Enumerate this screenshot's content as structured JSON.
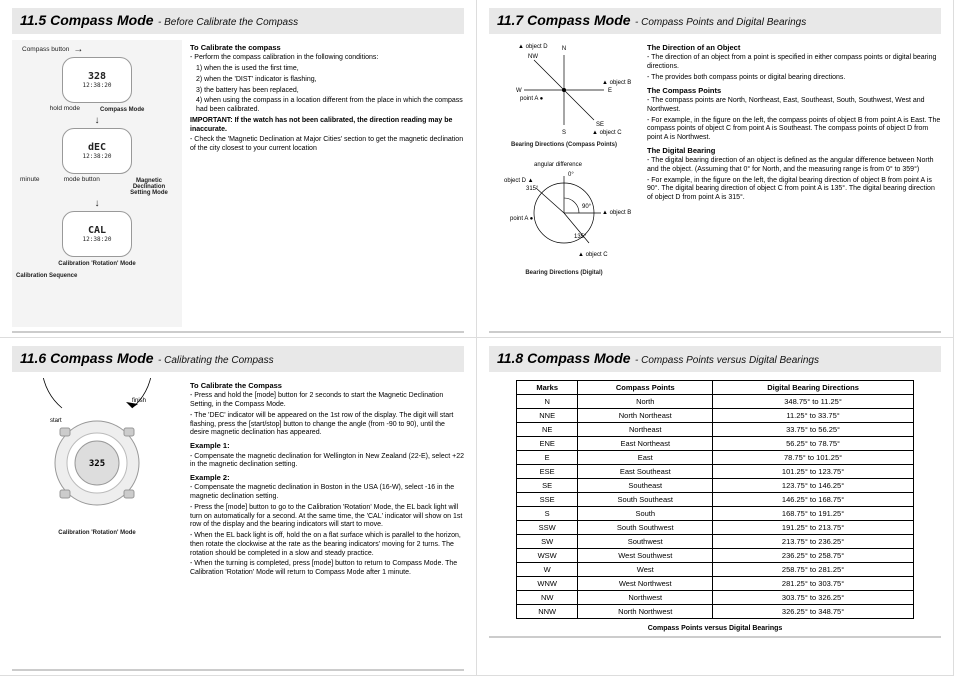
{
  "p115": {
    "num": "11.5 Compass Mode",
    "sub": "- Before Calibrate the Compass",
    "fig": {
      "compass_button": "Compass button",
      "hold_mode": "hold mode",
      "compass_mode": "Compass Mode",
      "minute": "minute",
      "mode_button": "mode button",
      "mag_dec": "Magnetic Declination Setting Mode",
      "cal_rot": "Calibration 'Rotation' Mode",
      "cal_seq": "Calibration Sequence",
      "disp1_big": "328",
      "disp1_time": "12:38:20",
      "disp2_big": "dEC",
      "disp2_time": "12:38:20",
      "disp3_big": "CAL",
      "disp3_time": "12:38:20"
    },
    "text": {
      "h1": "To Calibrate the compass",
      "p1": "- Perform the compass calibration in the following conditions:",
      "l1": "1) when the       is used the first time,",
      "l2": "2) when the 'DIST' indicator is flashing,",
      "l3": "3) the battery has been replaced,",
      "l4": "4) when using the compass in a location different from the place in which the compass had been calibrated.",
      "imp": "IMPORTANT: If the watch has not been calibrated, the direction reading may be inaccurate.",
      "p2": "- Check the 'Magnetic Declination at Major Cities' section to get the magnetic declination of the city closest to your current location"
    }
  },
  "p116": {
    "num": "11.6 Compass Mode",
    "sub": "- Calibrating the Compass",
    "fig": {
      "start": "start",
      "finish": "finish",
      "label": "Calibration 'Rotation' Mode",
      "disp": "325"
    },
    "text": {
      "h1": "To Calibrate the Compass",
      "p1": "- Press and hold the [mode] button for 2 seconds to start the Magnetic Declination Setting, in the Compass Mode.",
      "p2": "- The 'DEC' indicator will be appeared on the 1st row of the display. The digit will start flashing, press the [start/stop] button to change the angle (from -90 to 90), until the desire magnetic declination has appeared.",
      "ex1": "Example 1:",
      "p3": "- Compensate the magnetic declination for Wellington in New Zealand (22-E), select +22 in the magnetic declination setting.",
      "ex2": "Example 2:",
      "p4": "- Compensate the magnetic declination in Boston in the USA (16-W), select -16 in the magnetic declination setting.",
      "p5": "- Press the [mode] button to go to the Calibration 'Rotation' Mode, the EL back light will turn on automatically for a second. At the same time, the 'CAL' indicator will show on 1st row of the display and the bearing indicators will start to move.",
      "p6": "- When the EL back light is off, hold the        on a flat surface which is parallel to the horizon, then rotate the        clockwise at the rate as the bearing indicators' moving for 2 turns. The rotation should be completed in a slow and steady practice.",
      "p7": "- When the turning is completed, press [mode] button to return to Compass Mode. The Calibration 'Rotation' Mode will return to Compass Mode after 1 minute."
    }
  },
  "p117": {
    "num": "11.7 Compass Mode",
    "sub": "- Compass Points and Digital Bearings",
    "fig1": {
      "n": "N",
      "s": "S",
      "e": "E",
      "w": "W",
      "nw": "NW",
      "se": "SE",
      "objD": "▲ object D",
      "objB": "▲ object B",
      "objC": "▲ object C",
      "ptA": "point A ●",
      "cap": "Bearing Directions (Compass Points)"
    },
    "fig2": {
      "ang": "angular difference",
      "zero": "0°",
      "ninety": "90°",
      "onethirty": "135°",
      "threefifteen": "315°",
      "objD": "object D ▲",
      "ptA": "point A ●",
      "objB": "▲ object B",
      "objC": "▲ object C",
      "cap": "Bearing Directions (Digital)"
    },
    "text": {
      "h1": "The Direction of an Object",
      "p1": "- The direction of an object from a point is specified in either compass points or digital bearing directions.",
      "p2": "- The        provides both compass points or digital bearing directions.",
      "h2": "The Compass Points",
      "p3": "- The compass points are North, Northeast, East, Southeast, South, Southwest, West and Northwest.",
      "p4": "- For example, in the figure on the left, the compass points of object B from point A is East. The compass points of object C from point A is Southeast. The compass points of object D from point A is Northwest.",
      "h3": "The Digital Bearing",
      "p5": "- The digital bearing direction of an object is defined as the angular difference between North and the object. (Assuming that 0° for North, and the measuring range is from 0° to 359°)",
      "p6": "- For example, in the figure on the left, the digital bearing direction of object B from point A is 90°. The digital bearing direction of object C from point A is 135°. The digital bearing direction of object D from point A is 315°."
    }
  },
  "p118": {
    "num": "11.8 Compass Mode",
    "sub": "- Compass Points versus Digital Bearings",
    "headers": {
      "c1": "Marks",
      "c2": "Compass Points",
      "c3": "Digital Bearing Directions"
    },
    "rows": [
      {
        "m": "N",
        "p": "North",
        "d": "348.75° to 11.25°"
      },
      {
        "m": "NNE",
        "p": "North Northeast",
        "d": "11.25° to 33.75°"
      },
      {
        "m": "NE",
        "p": "Northeast",
        "d": "33.75° to 56.25°"
      },
      {
        "m": "ENE",
        "p": "East Northeast",
        "d": "56.25° to 78.75°"
      },
      {
        "m": "E",
        "p": "East",
        "d": "78.75° to 101.25°"
      },
      {
        "m": "ESE",
        "p": "East Southeast",
        "d": "101.25° to 123.75°"
      },
      {
        "m": "SE",
        "p": "Southeast",
        "d": "123.75° to 146.25°"
      },
      {
        "m": "SSE",
        "p": "South Southeast",
        "d": "146.25° to 168.75°"
      },
      {
        "m": "S",
        "p": "South",
        "d": "168.75° to 191.25°"
      },
      {
        "m": "SSW",
        "p": "South Southwest",
        "d": "191.25° to 213.75°"
      },
      {
        "m": "SW",
        "p": "Southwest",
        "d": "213.75° to 236.25°"
      },
      {
        "m": "WSW",
        "p": "West Southwest",
        "d": "236.25° to 258.75°"
      },
      {
        "m": "W",
        "p": "West",
        "d": "258.75° to 281.25°"
      },
      {
        "m": "WNW",
        "p": "West Northwest",
        "d": "281.25° to 303.75°"
      },
      {
        "m": "NW",
        "p": "Northwest",
        "d": "303.75° to 326.25°"
      },
      {
        "m": "NNW",
        "p": "North Northwest",
        "d": "326.25° to 348.75°"
      }
    ],
    "caption": "Compass Points versus Digital Bearings"
  }
}
